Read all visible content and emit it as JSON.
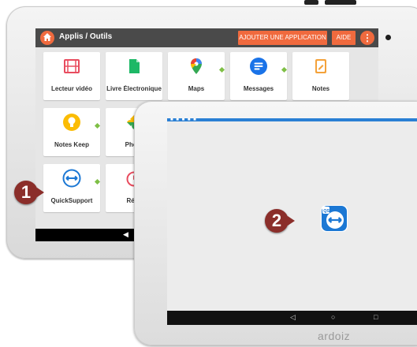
{
  "back_tablet": {
    "header": {
      "title": "Applis / Outils",
      "add_app_button": "AJOUTER UNE APPLICATION",
      "help_button": "AIDE",
      "more_button": "⋮"
    },
    "apps": [
      {
        "label": "Lecteur vidéo",
        "icon": "film-icon",
        "color": "#e84c5f"
      },
      {
        "label": "Livre Électronique",
        "icon": "ebook-icon",
        "color": "#1db866"
      },
      {
        "label": "Maps",
        "icon": "maps-pin-icon",
        "color": "#34a853"
      },
      {
        "label": "Messages",
        "icon": "messages-icon",
        "color": "#1a73e8"
      },
      {
        "label": "Notes",
        "icon": "note-icon",
        "color": "#f4a23a"
      },
      {
        "label": "Notes Keep",
        "icon": "lightbulb-icon",
        "color": "#fbbc04"
      },
      {
        "label": "Photo",
        "icon": "pinwheel-icon",
        "color": "#ea4335"
      },
      {
        "label": "QuickSupport",
        "icon": "quicksupport-icon",
        "color": "#1c78d4"
      },
      {
        "label": "Réve",
        "icon": "alarm-clock-icon",
        "color": "#e84c5f"
      }
    ],
    "nav_back": "◀"
  },
  "front_tablet": {
    "status_dots": "■ ■ ■ ■ ■",
    "app_icon": "quicksupport-icon",
    "nav": {
      "back": "◁",
      "home": "○",
      "recent": "□"
    },
    "brand": "ardoiz"
  },
  "callouts": {
    "one": "1",
    "two": "2"
  },
  "colors": {
    "accent": "#f06a3e",
    "badge": "#8b2e2a",
    "status_bar": "#2a7fd4"
  }
}
